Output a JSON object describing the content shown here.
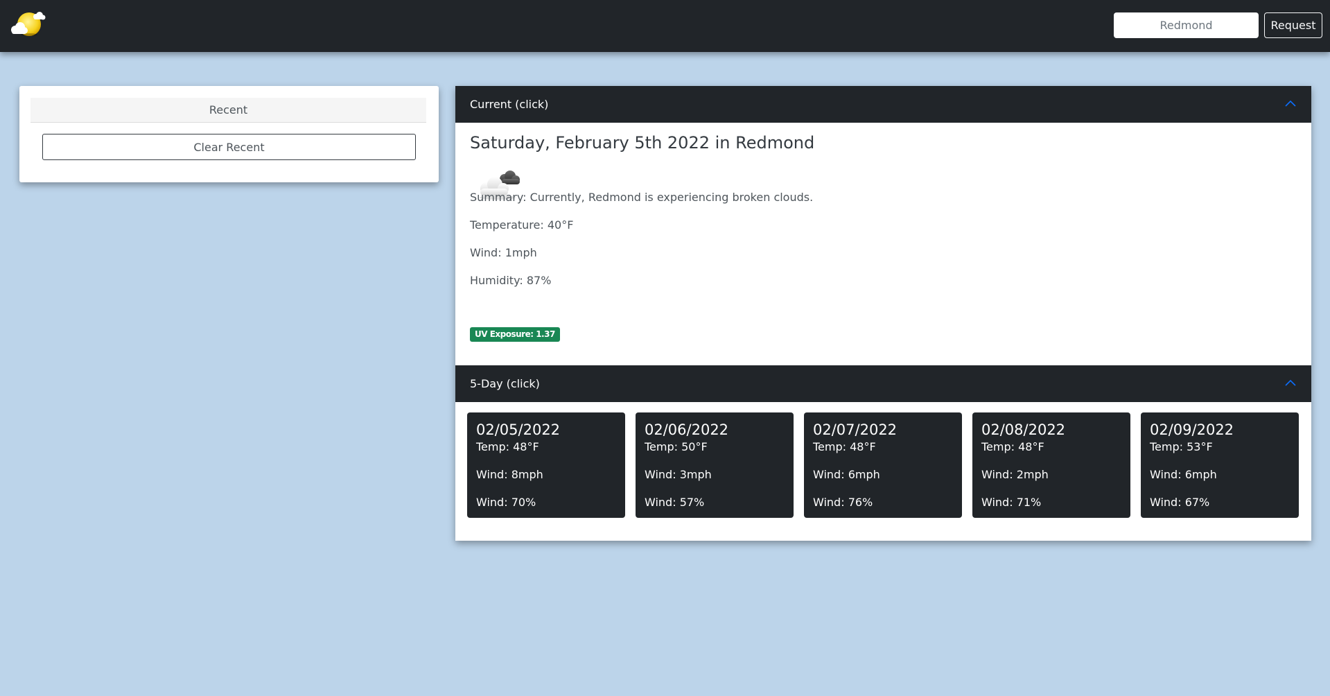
{
  "navbar": {
    "logo_icon": "sun-behind-cloud-icon",
    "search": {
      "value": "",
      "placeholder": "Redmond"
    },
    "request_label": "Request"
  },
  "recent": {
    "header": "Recent",
    "clear_label": "Clear Recent"
  },
  "current": {
    "header": "Current (click)",
    "date_title": "Saturday, February 5th 2022 in Redmond",
    "icon": "broken-clouds-icon",
    "summary": "Summary: Currently, Redmond is experiencing broken clouds.",
    "temperature": "Temperature: 40°F",
    "wind": "Wind: 1mph",
    "humidity": "Humidity: 87%",
    "uv": "UV Exposure: 1.37",
    "uv_color": "#198754"
  },
  "forecast": {
    "header": "5-Day (click)",
    "days": [
      {
        "date": "02/05/2022",
        "temp": "Temp: 48°F",
        "wind": "Wind: 8mph",
        "humidity": "Wind: 70%"
      },
      {
        "date": "02/06/2022",
        "temp": "Temp: 50°F",
        "wind": "Wind: 3mph",
        "humidity": "Wind: 57%"
      },
      {
        "date": "02/07/2022",
        "temp": "Temp: 48°F",
        "wind": "Wind: 6mph",
        "humidity": "Wind: 76%"
      },
      {
        "date": "02/08/2022",
        "temp": "Temp: 48°F",
        "wind": "Wind: 2mph",
        "humidity": "Wind: 71%"
      },
      {
        "date": "02/09/2022",
        "temp": "Temp: 53°F",
        "wind": "Wind: 6mph",
        "humidity": "Wind: 67%"
      }
    ]
  },
  "colors": {
    "background": "#bcd4ea",
    "dark": "#212529",
    "accent": "#0d6efd"
  }
}
